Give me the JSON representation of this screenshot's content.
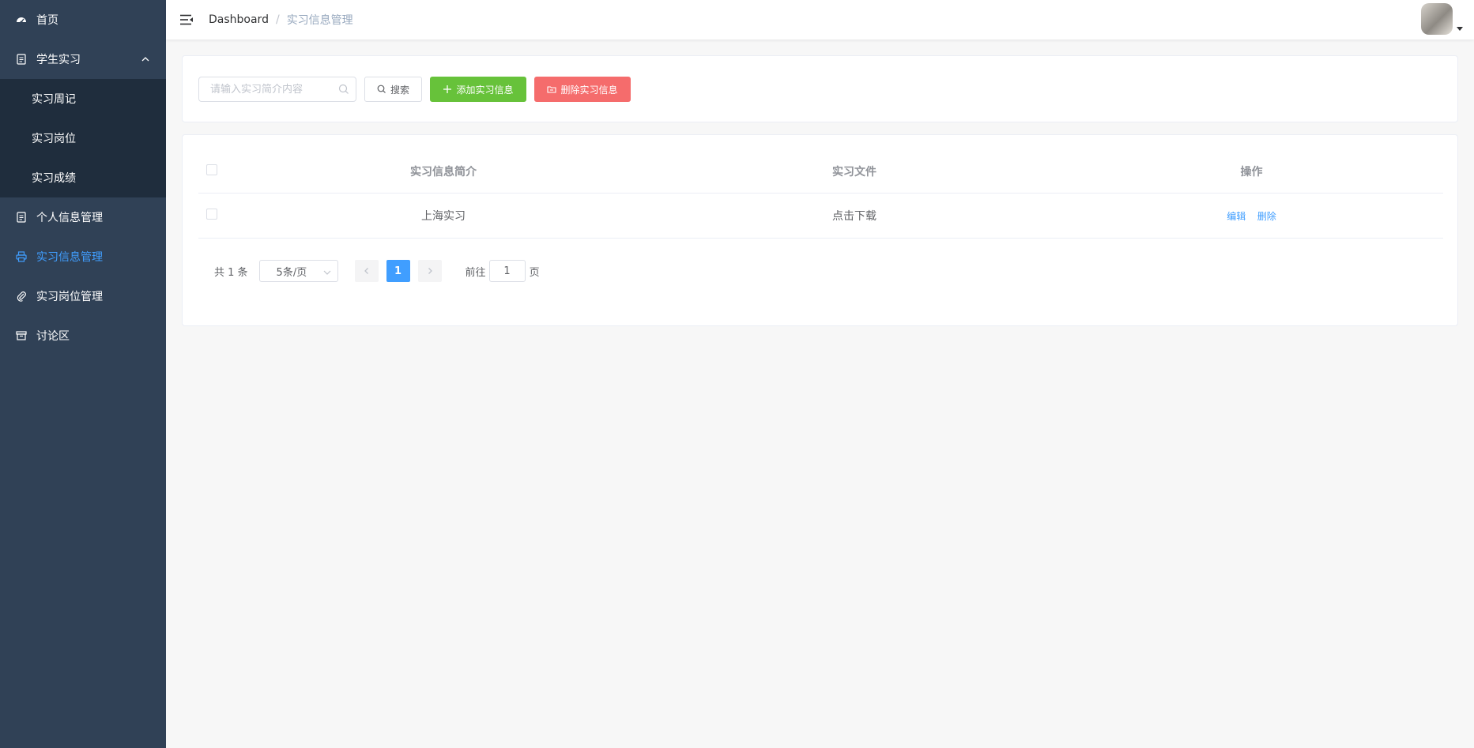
{
  "sidebar": {
    "items": [
      {
        "label": "首页",
        "icon": "dashboard-icon"
      },
      {
        "label": "学生实习",
        "icon": "document-icon",
        "expanded": true,
        "children": [
          {
            "label": "实习周记"
          },
          {
            "label": "实习岗位"
          },
          {
            "label": "实习成绩"
          }
        ]
      },
      {
        "label": "个人信息管理",
        "icon": "document-icon"
      },
      {
        "label": "实习信息管理",
        "icon": "printer-icon",
        "active": true
      },
      {
        "label": "实习岗位管理",
        "icon": "paperclip-icon"
      },
      {
        "label": "讨论区",
        "icon": "archive-icon"
      }
    ],
    "active_color": "#409eff",
    "background": "#304156"
  },
  "navbar": {
    "breadcrumb": [
      "Dashboard",
      "实习信息管理"
    ],
    "separator": "/"
  },
  "toolbar": {
    "search_placeholder": "请输入实习简介内容",
    "search_label": "搜索",
    "add_label": "添加实习信息",
    "delete_label": "删除实习信息"
  },
  "table": {
    "headers": [
      "实习信息简介",
      "实习文件",
      "操作"
    ],
    "rows": [
      {
        "intro": "上海实习",
        "file": "点击下载",
        "actions": [
          "编辑",
          "删除"
        ]
      }
    ]
  },
  "pagination": {
    "total_text": "共 1 条",
    "page_size": "5条/页",
    "current_page": "1",
    "goto_prefix": "前往",
    "goto_value": "1",
    "goto_suffix": "页"
  }
}
